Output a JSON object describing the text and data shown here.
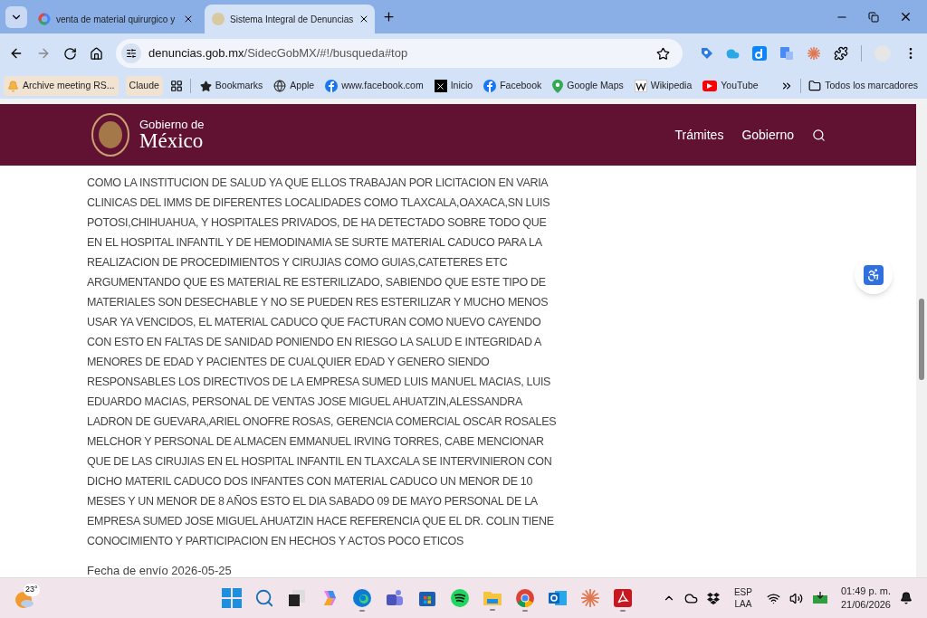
{
  "tabs": [
    {
      "title": "venta de material quirurgico y",
      "selected": false,
      "kind": "google"
    },
    {
      "title": "Sistema Integral de Denuncias",
      "selected": true,
      "kind": "seal"
    }
  ],
  "address": {
    "host": "denuncias.gob.mx",
    "path": "/SidecGobMX/#!/busqueda#top"
  },
  "bookmarks": [
    {
      "label": "Archive meeting RS...",
      "kind": "bell"
    },
    {
      "label": "Claude",
      "kind": "plain"
    },
    {
      "label": "Bookmarks",
      "kind": "star"
    },
    {
      "label": "Apple",
      "kind": "globe"
    },
    {
      "label": "www.facebook.com",
      "kind": "facebook"
    },
    {
      "label": "Inicio",
      "kind": "x"
    },
    {
      "label": "Facebook",
      "kind": "facebook"
    },
    {
      "label": "Google Maps",
      "kind": "maps"
    },
    {
      "label": "Wikipedia",
      "kind": "wiki"
    },
    {
      "label": "YouTube",
      "kind": "youtube"
    }
  ],
  "all_bookmarks": "Todos los marcadores",
  "site": {
    "brand_small": "Gobierno de",
    "brand_big": "México",
    "nav": [
      "Trámites",
      "Gobierno"
    ]
  },
  "complaint_lines": [
    "COMO LA INSTITUCION DE SALUD YA QUE ELLOS TRABAJAN POR LICITACION EN VARIA",
    "CLINICAS DEL IMMS DE DIFERENTES LOCALIDADES COMO TLAXCALA,OAXACA,SN LUIS",
    "POTOSI,CHIHUAHUA, Y HOSPITALES PRIVADOS, DE HA DETECTADO SOBRE TODO QUE",
    "EN EL HOSPITAL INFANTIL Y DE HEMODINAMIA SE SURTE MATERIAL CADUCO PARA LA",
    "REALIZACION DE PROCEDIMIENTOS Y CIRUJIAS COMO GUIAS,CATETERES ETC",
    "ARGUMENTANDO QUE ES MATERIAL RE ESTERILIZADO, SABIENDO QUE ESTE TIPO DE",
    "MATERIALES SON DESECHABLE Y NO SE PUEDEN RES ESTERILIZAR Y MUCHO MENOS",
    "USAR YA VENCIDOS, EL MATERIAL CADUCO QUE FACTURAN COMO NUEVO CAYENDO",
    "CON ESTO EN FALTAS DE SANIDAD PONIENDO EN RIESGO LA SALUD E INTEGRIDAD A",
    "MENORES DE EDAD Y PACIENTES DE CUALQUIER EDAD Y GENERO SIENDO",
    "RESPONSABLES LOS DIRECTIVOS DE LA EMPRESA SUMED LUIS MANUEL MACIAS, LUIS",
    "EDUARDO MACIAS, PERSONAL DE VENTAS JOSE MIGUEL AHUATZIN,ALESSANDRA",
    "LADRON DE GUEVARA,ARIEL ONOFRE ROSAS, GERENCIA COMERCIAL OSCAR ROSALES",
    "MELCHOR Y PERSONAL DE ALMACEN EMMANUEL IRVING TORRES, CABE MENCIONAR",
    "QUE DE LAS CIRUJIAS EN EL HOSPITAL INFANTIL EN TLAXCALA SE INTERVINIERON CON",
    "DICHO MATERIL CADUCO DOS INFANTES CON MATERIAL CADUCO UN MENOR DE 10",
    "MESES Y UN MENOR DE 8 AÑOS ESTO EL DIA SABADO 09 DE MAYO PERSONAL DE LA",
    "EMPRESA SUMED JOSE MIGUEL AHUATZIN HACE REFERENCIA QUE EL DR. COLIN TIENE",
    "CONOCIMIENTO Y PARTICIPACION EN HECHOS Y ACTOS POCO ETICOS"
  ],
  "sent_date": "Fecha de envío 2026-05-25",
  "taskbar": {
    "temperature": "23°",
    "apps": [
      {
        "kind": "windows",
        "active": false
      },
      {
        "kind": "search",
        "active": false
      },
      {
        "kind": "taskview",
        "active": false
      },
      {
        "kind": "copilot",
        "active": false
      },
      {
        "kind": "edge",
        "active": true
      },
      {
        "kind": "teams",
        "active": false
      },
      {
        "kind": "store",
        "active": false
      },
      {
        "kind": "spotify",
        "active": false
      },
      {
        "kind": "folder",
        "active": true
      },
      {
        "kind": "chrome",
        "active": true
      },
      {
        "kind": "outlook",
        "active": false
      },
      {
        "kind": "claude",
        "active": false
      },
      {
        "kind": "pdf",
        "active": true
      }
    ],
    "lang_top": "ESP",
    "lang_bottom": "LAA",
    "time": "01:49 p. m.",
    "date": "21/06/2026"
  }
}
